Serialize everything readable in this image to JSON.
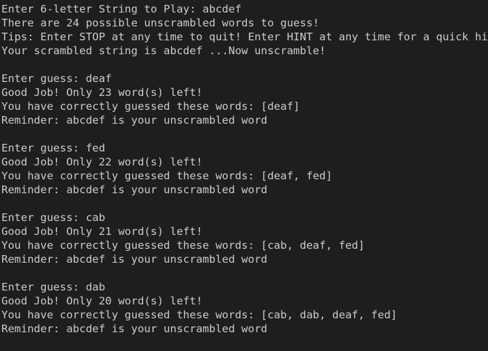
{
  "terminal": {
    "text_color": "#cccccc",
    "background_color": "#1e1e1e",
    "intro": [
      "Enter 6-letter String to Play: abcdef",
      "There are 24 possible unscrambled words to guess!",
      "Tips: Enter STOP at any time to quit! Enter HINT at any time for a quick hint",
      "Your scrambled string is abcdef ...Now unscramble!"
    ],
    "rounds": [
      {
        "guess": "Enter guess: deaf",
        "result": "Good Job! Only 23 word(s) left!",
        "guessed": "You have correctly guessed these words: [deaf]",
        "reminder": "Reminder: abcdef is your unscrambled word"
      },
      {
        "guess": "Enter guess: fed",
        "result": "Good Job! Only 22 word(s) left!",
        "guessed": "You have correctly guessed these words: [deaf, fed]",
        "reminder": "Reminder: abcdef is your unscrambled word"
      },
      {
        "guess": "Enter guess: cab",
        "result": "Good Job! Only 21 word(s) left!",
        "guessed": "You have correctly guessed these words: [cab, deaf, fed]",
        "reminder": "Reminder: abcdef is your unscrambled word"
      },
      {
        "guess": "Enter guess: dab",
        "result": "Good Job! Only 20 word(s) left!",
        "guessed": "You have correctly guessed these words: [cab, dab, deaf, fed]",
        "reminder": "Reminder: abcdef is your unscrambled word"
      }
    ]
  }
}
